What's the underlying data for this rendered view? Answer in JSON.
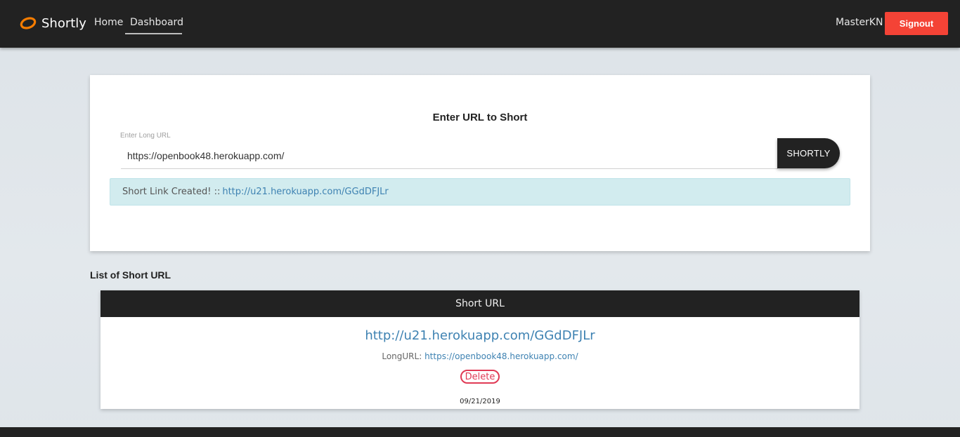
{
  "navbar": {
    "brand": "Shortly",
    "brand_icon": "orange-ring-logo-icon",
    "links": [
      "Home",
      "Dashboard"
    ],
    "active_link": "Dashboard",
    "username": "MasterKN",
    "signout_label": "Signout",
    "signout_color": "#f44336"
  },
  "shortener": {
    "title": "Enter URL to Short",
    "input_label": "Enter Long URL",
    "input_value": "https://openbook48.herokuapp.com/",
    "button_label": "SHORTLY",
    "alert_text": "Short Link Created! ::",
    "alert_link": "http://u21.herokuapp.com/GGdDFJLr"
  },
  "list": {
    "title": "List of Short URL",
    "header": "Short URL",
    "items": [
      {
        "short_url": "http://u21.herokuapp.com/GGdDFJLr",
        "long_label": "LongURL:",
        "long_url": "https://openbook48.herokuapp.com/",
        "delete_label": "Delete",
        "date": "09/21/2019"
      }
    ]
  }
}
